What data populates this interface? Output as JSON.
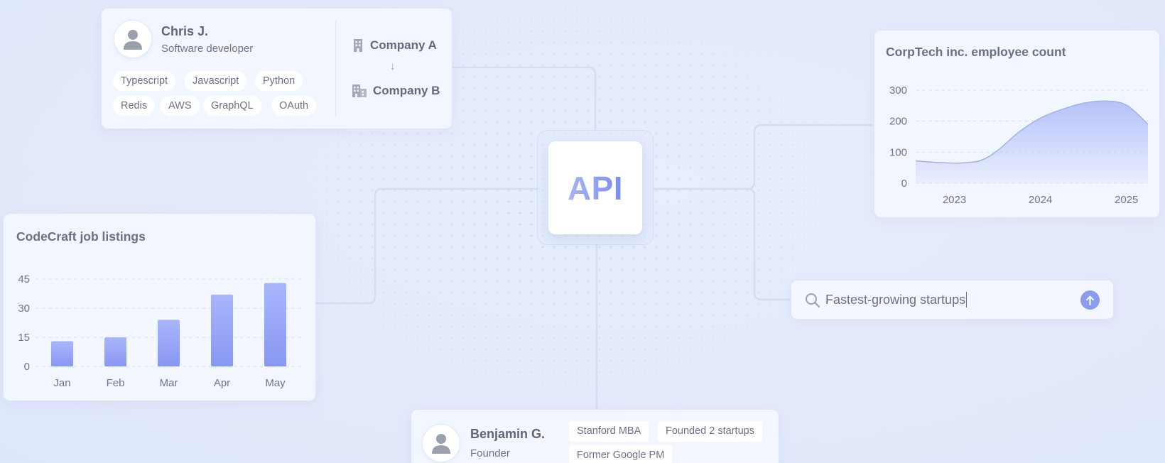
{
  "center": {
    "label": "API"
  },
  "profile_top": {
    "name": "Chris J.",
    "role": "Software developer",
    "skills": [
      "Typescript",
      "Javascript",
      "Python",
      "Redis",
      "AWS",
      "GraphQL",
      "OAuth"
    ],
    "company_from": "Company A",
    "arrow": "↓",
    "company_to": "Company B"
  },
  "profile_bottom": {
    "name": "Benjamin G.",
    "role": "Founder",
    "tags": [
      "Stanford MBA",
      "Founded 2 startups",
      "Former Google PM"
    ]
  },
  "search": {
    "query": "Fastest-growing startups"
  },
  "icons": {
    "avatar": "user-icon",
    "company": "building-icon",
    "search": "search-icon",
    "send": "arrow-up-icon"
  },
  "colors": {
    "accent": "#8c9cf1",
    "bar_top": "#a8b6fb",
    "bar_bottom": "#8897f2",
    "area_fill": "#b3bff8",
    "area_line": "#a1afef"
  },
  "chart_data": [
    {
      "type": "bar",
      "title": "CodeCraft job listings",
      "categories": [
        "Jan",
        "Feb",
        "Mar",
        "Apr",
        "May"
      ],
      "values": [
        13,
        15,
        24,
        37,
        43
      ],
      "yticks": [
        0,
        15,
        30,
        45
      ],
      "ylim": [
        0,
        45
      ],
      "grid": true,
      "legend": "none"
    },
    {
      "type": "area",
      "title": "CorpTech inc. employee count",
      "x": [
        2022.55,
        2022.8,
        2023.05,
        2023.3,
        2023.5,
        2023.75,
        2024.0,
        2024.25,
        2024.5,
        2024.75,
        2025.0,
        2025.25
      ],
      "values": [
        72,
        67,
        65,
        73,
        105,
        165,
        210,
        238,
        258,
        265,
        252,
        190
      ],
      "xticks": [
        2023,
        2024,
        2025
      ],
      "xlim": [
        2022.55,
        2025.25
      ],
      "yticks": [
        0,
        100,
        200,
        300
      ],
      "ylim": [
        0,
        300
      ],
      "grid": true,
      "legend": "none"
    }
  ]
}
